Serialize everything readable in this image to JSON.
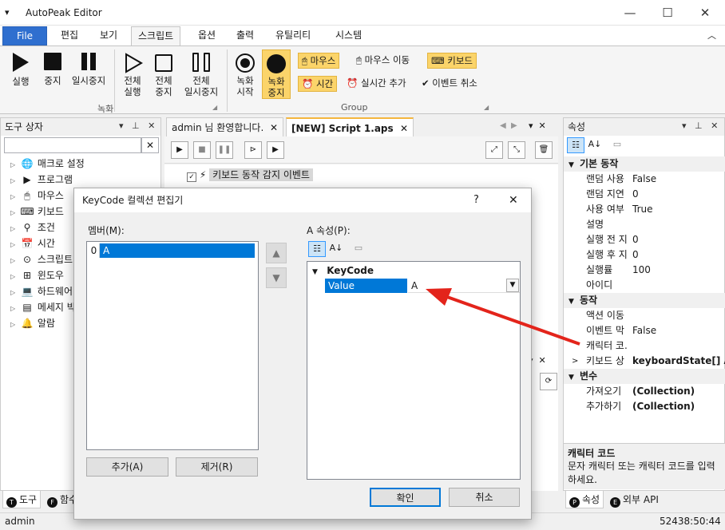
{
  "window": {
    "menu_glyph": "▾",
    "title": "AutoPeak Editor",
    "minimize": "—",
    "maximize": "☐",
    "close": "✕"
  },
  "ribbon": {
    "tabs": [
      "File",
      "편집",
      "보기",
      "스크립트",
      "옵션",
      "출력",
      "유틸리티",
      "시스템"
    ],
    "collapse_glyph": "︿",
    "record_group": {
      "label": "녹화",
      "buttons": [
        {
          "l1": "실행",
          "l2": ""
        },
        {
          "l1": "중지",
          "l2": ""
        },
        {
          "l1": "일시중지",
          "l2": ""
        },
        {
          "l1": "전체",
          "l2": "실행"
        },
        {
          "l1": "전체",
          "l2": "중지"
        },
        {
          "l1": "전체",
          "l2": "일시중지"
        }
      ]
    },
    "group2": {
      "label": "Group",
      "rec_start": {
        "l1": "녹화",
        "l2": "시작"
      },
      "rec_stop": {
        "l1": "녹화",
        "l2": "중지"
      },
      "mouse": "마우스",
      "mouse_move": "마우스 이동",
      "keyboard": "키보드",
      "time": "시간",
      "realtime_add": "실시간 추가",
      "event_cancel": "이벤트 취소"
    }
  },
  "toolbox": {
    "title": "도구 상자",
    "search_value": "",
    "clear": "✕",
    "items": [
      "매크로 설정",
      "프로그램",
      "마우스",
      "키보드",
      "조건",
      "시간",
      "스크립트",
      "윈도우",
      "하드웨어",
      "메세지 박스",
      "알람"
    ],
    "bottom_tabs": [
      {
        "badge": "T",
        "label": "도구"
      },
      {
        "badge": "F",
        "label": "함수"
      }
    ]
  },
  "docs": {
    "tabs": [
      {
        "label": "admin 님 환영합니다.",
        "active": false
      },
      {
        "label": "[NEW] Script 1.aps",
        "active": true
      }
    ],
    "event_label": "키보드 동작 감지 이벤트"
  },
  "props": {
    "title": "속성",
    "categories": [
      {
        "name": "기본 동작",
        "rows": [
          {
            "k": "랜덤 사용",
            "v": "False"
          },
          {
            "k": "랜덤 지연",
            "v": "0"
          },
          {
            "k": "사용 여부",
            "v": "True"
          },
          {
            "k": "설명",
            "v": ""
          },
          {
            "k": "실행 전 지",
            "v": "0"
          },
          {
            "k": "실행 후 지",
            "v": "0"
          },
          {
            "k": "실행률",
            "v": "100"
          },
          {
            "k": "아이디",
            "v": ""
          }
        ]
      },
      {
        "name": "동작",
        "rows": [
          {
            "k": "액션 이동",
            "v": ""
          },
          {
            "k": "이벤트 막",
            "v": "False"
          },
          {
            "k": "캐릭터 코.",
            "v": ""
          },
          {
            "k": "키보드 상",
            "v": "keyboardState[] Ar"
          }
        ]
      },
      {
        "name": "변수",
        "rows": [
          {
            "k": "가져오기",
            "v": "(Collection)"
          },
          {
            "k": "추가하기",
            "v": "(Collection)"
          }
        ]
      }
    ],
    "desc_title": "캐릭터 코드",
    "desc_text": "문자 캐릭터 또는 캐릭터 코드를 입력하세요.",
    "bottom_tabs": [
      {
        "badge": "P",
        "label": "속성"
      },
      {
        "badge": "E",
        "label": "외부 API"
      }
    ]
  },
  "dialog": {
    "title": "KeyCode 컬렉션 편집기",
    "help": "?",
    "close": "✕",
    "members_label": "멤버(M):",
    "members": [
      {
        "index": "0",
        "value": "A"
      }
    ],
    "props_label": "A 속성(P):",
    "category": "KeyCode",
    "prop_name": "Value",
    "prop_value": "A",
    "add": "추가(A)",
    "remove": "제거(R)",
    "ok": "확인",
    "cancel": "취소",
    "up": "▲",
    "down": "▼"
  },
  "status": {
    "left": "admin",
    "right": "52438:50:44"
  },
  "colors": {
    "accent": "#0078d7",
    "file_tab": "#2f6fcf",
    "highlight": "#fbd46a",
    "arrow": "#e3241b"
  }
}
